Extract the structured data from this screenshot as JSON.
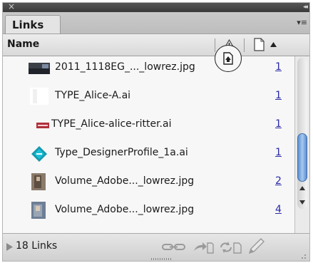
{
  "panel": {
    "close_glyph": "×",
    "collapse_glyph": "◂◂",
    "tab_label": "Links",
    "menu_glyph": "▾≡"
  },
  "columns": {
    "name_header": "Name",
    "status_icon": "warning-triangle-icon",
    "page_icon": "page-icon",
    "sort_icon": "sort-ascending-icon"
  },
  "rows": [
    {
      "name": "2011_1118EG_..._lowrez.jpg",
      "page": "1",
      "thumb": "photo-thumbnail"
    },
    {
      "name": "TYPE_Alice-A.ai",
      "page": "1",
      "thumb": "blank-thumbnail",
      "status": "embedded-icon"
    },
    {
      "name": "TYPE_Alice-alice-ritter.ai",
      "page": "1",
      "thumb": "text-logo-thumbnail"
    },
    {
      "name": "Type_DesignerProfile_1a.ai",
      "page": "1",
      "thumb": "diamond-logo-thumbnail"
    },
    {
      "name": "Volume_Adobe..._lowrez.jpg",
      "page": "2",
      "thumb": "photo-thumbnail"
    },
    {
      "name": "Volume_Adobe..._lowrez.jpg",
      "page": "4",
      "thumb": "photo-thumbnail"
    }
  ],
  "footer": {
    "link_count": "18 Links",
    "icons": [
      "relink-icon",
      "go-to-link-icon",
      "update-link-icon",
      "edit-original-icon"
    ]
  },
  "colors": {
    "page_link": "#2a2aa8",
    "scroll_thumb": "#5c8fd0",
    "title_bar": "#3a3a3a"
  }
}
